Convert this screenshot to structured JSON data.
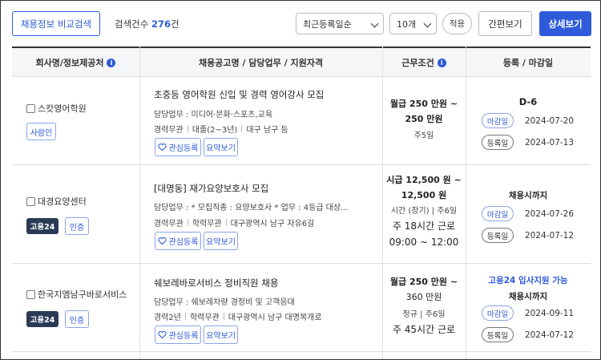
{
  "toolbar": {
    "compare_label": "채용정보 비교검색",
    "count_prefix": "검색건수",
    "count_value": "276",
    "count_suffix": "건",
    "sort_value": "최근등록일순",
    "size_value": "10개",
    "apply_label": "적용",
    "simple_view_label": "간편보기",
    "detail_view_label": "상세보기"
  },
  "table": {
    "headers": {
      "company": "회사명/정보제공처",
      "job": "채용공고명 / 담당업무 / 지원자격",
      "work": "근무조건",
      "dates": "등록 / 마감일"
    },
    "rows": [
      {
        "company": "스캇영어학원",
        "tag": "사람인",
        "title": "초중등 영어학원 신입 및 경력 영어강사 모집",
        "duty": "담당업무 : 미디어·문화·스포츠,교육",
        "conditions": [
          "경력무관",
          "대졸(2~3년)",
          "대구 남구 등"
        ],
        "fav_label": "관심등록",
        "summary_label": "요약보기",
        "pay_line1": "월급 250 만원 ~",
        "pay_line2": "250 만원",
        "work_days": "주5일",
        "dday": "D-6",
        "deadline_label": "마감일",
        "deadline_date": "2024-07-20",
        "reg_label": "등록일",
        "reg_date": "2024-07-13"
      },
      {
        "company": "대경요양센터",
        "tag": "고용24",
        "cert": "인증",
        "title": "[대명동] 재가요양보호사 모집",
        "duty": "담당업무 : * 모집직종 : 요양보호사 * 업무 : 4등급 대상...",
        "conditions": [
          "경력무관",
          "학력무관",
          "대구광역시 남구 자유6길"
        ],
        "fav_label": "관심등록",
        "summary_label": "요약보기",
        "pay_line1": "시급 12,500 원 ~",
        "pay_line2": "12,500 원",
        "time_type": "시간 (장기)",
        "work_days": "주6일",
        "weekly_hours": "주 18시간 근로",
        "hours": "09:00 ~ 12:00",
        "dday": "채용시까지",
        "deadline_label": "마감일",
        "deadline_date": "2024-07-26",
        "reg_label": "등록일",
        "reg_date": "2024-07-12"
      },
      {
        "company": "한국지엠남구바로서비스",
        "tag": "고용24",
        "cert": "인증",
        "title": "쉐보레바로서비스 정비직원 채용",
        "duty": "담당업무 : 쉐보레차량 경정비 및 고객응대",
        "conditions": [
          "경력2년",
          "학력무관",
          "대구광역시 남구 대명복개로"
        ],
        "fav_label": "관심등록",
        "summary_label": "요약보기",
        "pay_line1": "월급 250 만원 ~",
        "pay_line2": "360 만원",
        "time_type": "정규",
        "work_days": "주6일",
        "weekly_hours": "주 45시간 근로",
        "support": "고용24 입사지원 가능",
        "dday": "채용시까지",
        "deadline_label": "마감일",
        "deadline_date": "2024-09-11",
        "reg_label": "등록일",
        "reg_date": "2024-07-12"
      }
    ]
  },
  "colors": {
    "accent": "#2e5bd9",
    "badge_dark": "#2b3a55"
  }
}
